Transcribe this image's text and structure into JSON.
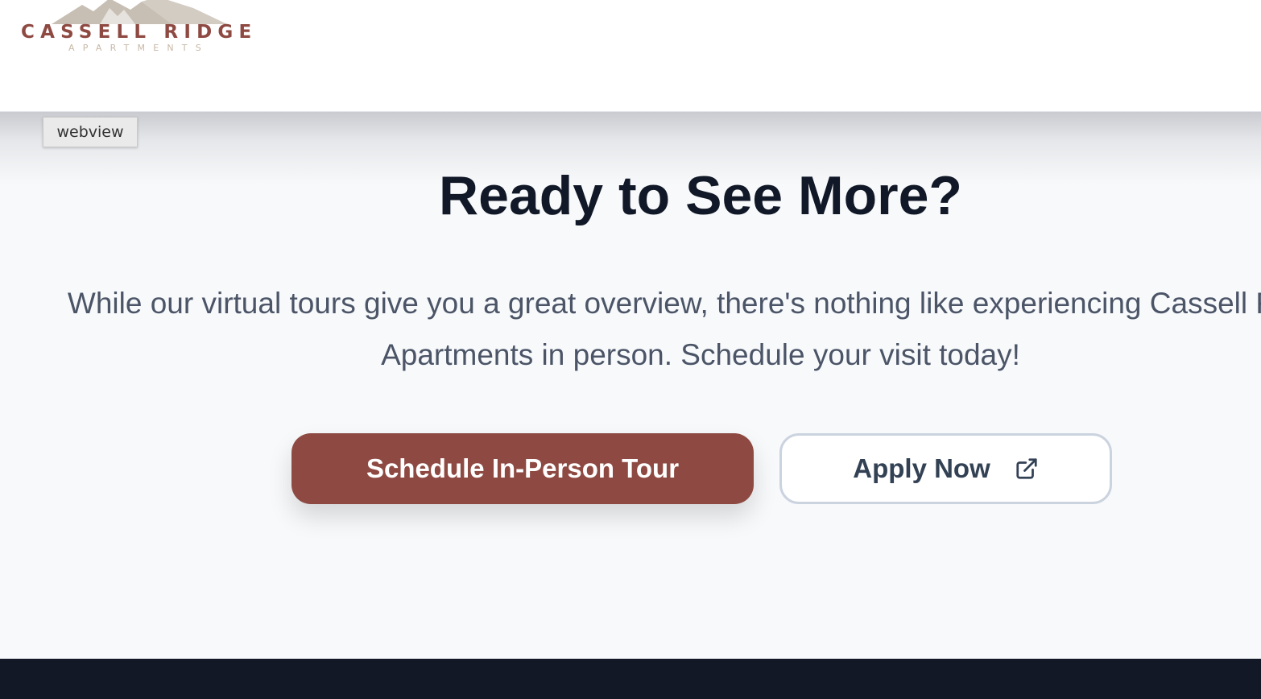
{
  "header": {
    "logo": {
      "name": "CASSELL RIDGE",
      "subtitle": "APARTMENTS"
    }
  },
  "overlay": {
    "webview_label": "webview"
  },
  "cta": {
    "title": "Ready to See More?",
    "description_line1": "While our virtual tours give you a great overview, there's nothing like experiencing Cassell Ridge",
    "description_line2": "Apartments in person. Schedule your visit today!",
    "schedule_button_label": "Schedule In-Person Tour",
    "apply_button_label": "Apply Now",
    "apply_button_icon": "external-link-icon"
  },
  "colors": {
    "brand": "#8e4a42",
    "heading": "#111827",
    "body_text": "#4b5567",
    "footer": "#121826",
    "logo_mountain": "#c8bfb4"
  }
}
